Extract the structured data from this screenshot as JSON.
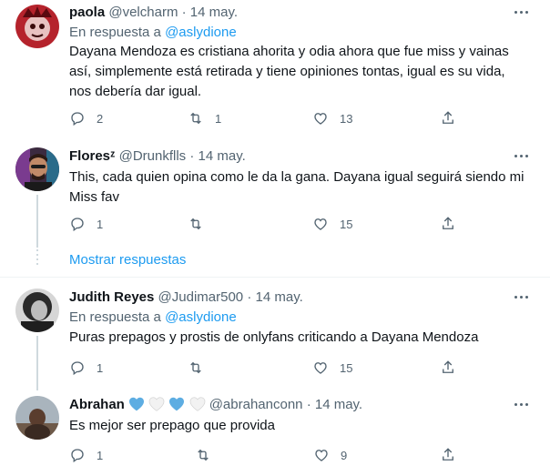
{
  "tweets": [
    {
      "name": "paola",
      "handle": "@velcharm",
      "dot": "·",
      "time": "14 may.",
      "reply_prefix": "En respuesta a",
      "reply_handle": "@aslydione",
      "text_lines": [
        "Dayana Mendoza es cristiana ahorita y odia ahora que fue miss y vainas",
        "así, simplemente está retirada y tiene opiniones tontas, igual es su vida,",
        "nos debería dar igual."
      ],
      "replies": "2",
      "retweets": "1",
      "likes": "13"
    },
    {
      "name": "Floresᶻ",
      "handle": "@Drunkflls",
      "dot": "·",
      "time": "14 may.",
      "text_lines": [
        "This, cada quien opina como le da la gana. Dayana igual seguirá siendo mi",
        "Miss fav"
      ],
      "replies": "1",
      "retweets": "",
      "likes": "15"
    },
    {
      "name": "Judith Reyes",
      "handle": "@Judimar500",
      "dot": "·",
      "time": "14 may.",
      "reply_prefix": "En respuesta a",
      "reply_handle": "@aslydione",
      "text_lines": [
        "Puras prepagos y prostis de onlyfans criticando a Dayana Mendoza"
      ],
      "replies": "1",
      "retweets": "",
      "likes": "15"
    },
    {
      "name": "Abrahan",
      "handle": "@abrahanconn",
      "dot": "·",
      "time": "14 may.",
      "text_lines": [
        "Es mejor ser prepago que provida"
      ],
      "replies": "1",
      "retweets": "",
      "likes": "9"
    }
  ],
  "show_replies": "Mostrar respuestas",
  "icons": {
    "reply": "reply-icon",
    "retweet": "retweet-icon",
    "like": "heart-icon",
    "share": "share-icon",
    "more": "more-icon"
  },
  "colors": {
    "link": "#1d9bf0",
    "muted": "#536471",
    "text": "#0f1419",
    "heart_blue": "#5dade2"
  }
}
